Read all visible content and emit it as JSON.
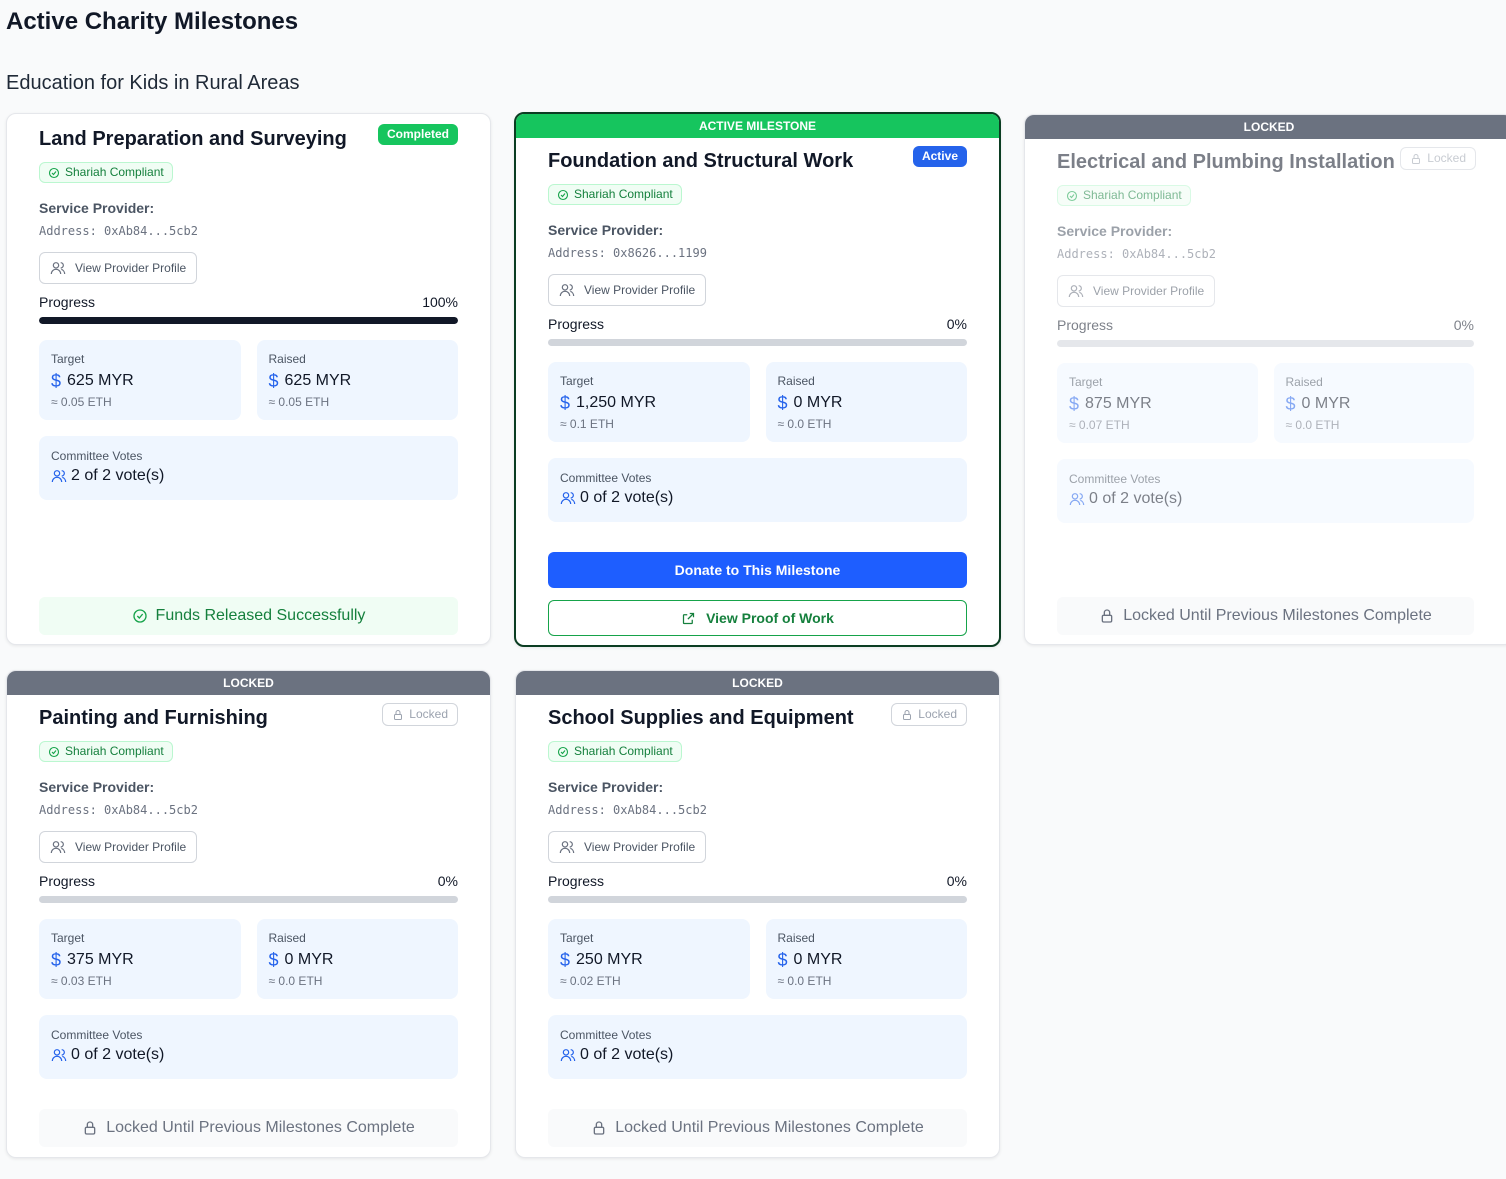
{
  "page": {
    "title": "Active Charity Milestones",
    "campaign_title": "Education for Kids in Rural Areas"
  },
  "colors": {
    "completed": "#16c55e",
    "active": "#2563eb",
    "donate_button": "#1e5eff",
    "locked_banner": "#6b7280",
    "shariah_text": "#15803d"
  },
  "labels": {
    "shariah": "Shariah Compliant",
    "service_provider": "Service Provider:",
    "view_profile": "View Provider Profile",
    "progress": "Progress",
    "target": "Target",
    "raised": "Raised",
    "committee_votes": "Committee Votes",
    "funds_released": "Funds Released Successfully",
    "locked_until": "Locked Until Previous Milestones Complete",
    "donate": "Donate to This Milestone",
    "view_proof": "View Proof of Work"
  },
  "milestones": [
    {
      "banner": "",
      "title": "Land Preparation and Surveying",
      "status": "Completed",
      "address": "Address: 0xAb84...5cb2",
      "progress_text": "100%",
      "progress": 1.0,
      "target": "625 MYR",
      "target_eth": "≈ 0.05 ETH",
      "raised": "625 MYR",
      "raised_eth": "≈ 0.05 ETH",
      "votes": "2 of 2 vote(s)"
    },
    {
      "banner": "ACTIVE MILESTONE",
      "title": "Foundation and Structural Work",
      "status": "Active",
      "address": "Address: 0x8626...1199",
      "progress_text": "0%",
      "progress": 0.0,
      "target": "1,250 MYR",
      "target_eth": "≈ 0.1 ETH",
      "raised": "0 MYR",
      "raised_eth": "≈ 0.0 ETH",
      "votes": "0 of 2 vote(s)"
    },
    {
      "banner": "LOCKED",
      "title": "Electrical and Plumbing Installation",
      "status": "Locked",
      "address": "Address: 0xAb84...5cb2",
      "progress_text": "0%",
      "progress": 0.0,
      "target": "875 MYR",
      "target_eth": "≈ 0.07 ETH",
      "raised": "0 MYR",
      "raised_eth": "≈ 0.0 ETH",
      "votes": "0 of 2 vote(s)"
    },
    {
      "banner": "LOCKED",
      "title": "Painting and Furnishing",
      "status": "Locked",
      "address": "Address: 0xAb84...5cb2",
      "progress_text": "0%",
      "progress": 0.0,
      "target": "375 MYR",
      "target_eth": "≈ 0.03 ETH",
      "raised": "0 MYR",
      "raised_eth": "≈ 0.0 ETH",
      "votes": "0 of 2 vote(s)"
    },
    {
      "banner": "LOCKED",
      "title": "School Supplies and Equipment",
      "status": "Locked",
      "address": "Address: 0xAb84...5cb2",
      "progress_text": "0%",
      "progress": 0.0,
      "target": "250 MYR",
      "target_eth": "≈ 0.02 ETH",
      "raised": "0 MYR",
      "raised_eth": "≈ 0.0 ETH",
      "votes": "0 of 2 vote(s)"
    }
  ]
}
